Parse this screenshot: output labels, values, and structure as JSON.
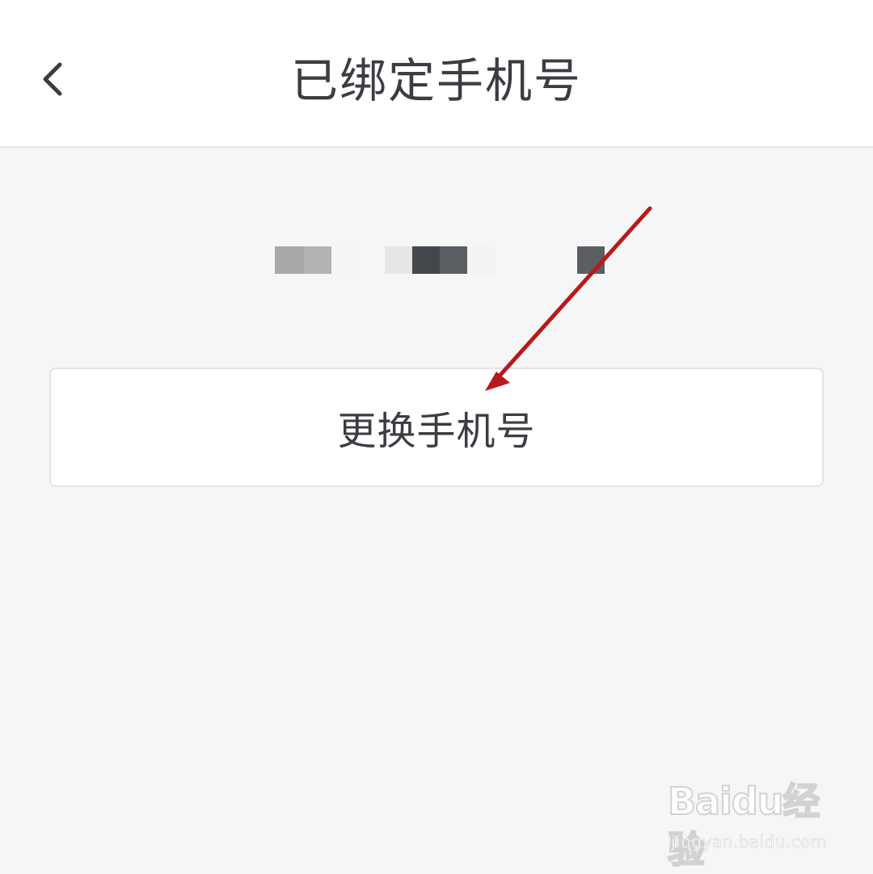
{
  "header": {
    "title": "已绑定手机号",
    "back_icon": "chevron-left-icon"
  },
  "phone": {
    "value_state": "pixelated / redacted"
  },
  "actions": {
    "change_phone_label": "更换手机号"
  },
  "watermark": {
    "logo_text": "Baidu经验",
    "url_text": "jingyan.baidu.com"
  },
  "colors": {
    "header_bg": "#ffffff",
    "page_bg": "#f6f6f6",
    "text": "#3a3d42",
    "annotation_arrow": "#b8191a"
  }
}
